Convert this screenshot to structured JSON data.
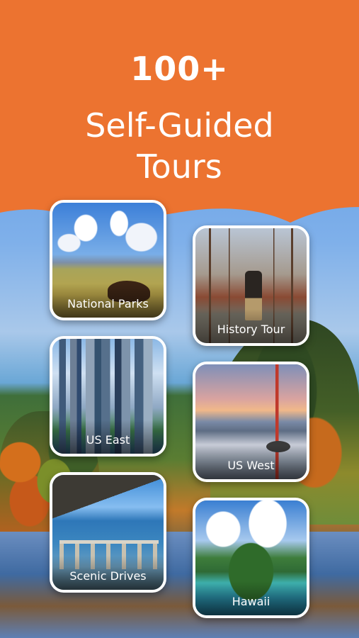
{
  "header": {
    "headline": "100+",
    "subheadline_line1": "Self-Guided",
    "subheadline_line2": "Tours",
    "background_color": "#EC7330"
  },
  "cards": [
    {
      "label": "National Parks"
    },
    {
      "label": "History Tour"
    },
    {
      "label": "US East"
    },
    {
      "label": "US West"
    },
    {
      "label": "Scenic Drives"
    },
    {
      "label": "Hawaii"
    }
  ]
}
